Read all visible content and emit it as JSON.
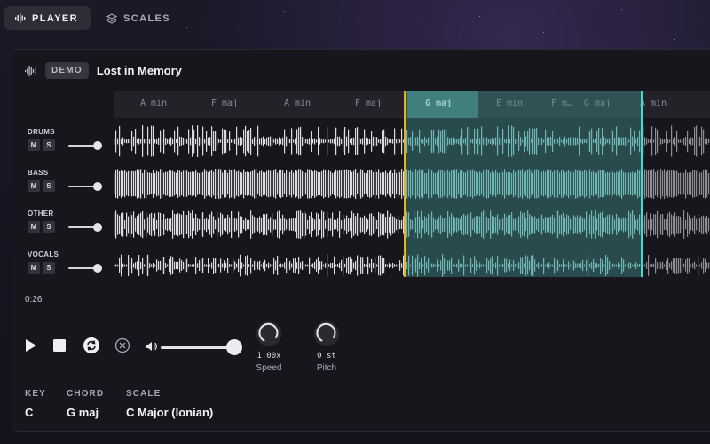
{
  "nav": {
    "tabs": [
      {
        "label": "PLAYER",
        "icon": "waveform-icon",
        "active": true
      },
      {
        "label": "SCALES",
        "icon": "layers-icon",
        "active": false
      }
    ]
  },
  "song": {
    "badge": "DEMO",
    "title": "Lost in Memory"
  },
  "chords": [
    {
      "label": "A min",
      "active": false
    },
    {
      "label": "F maj",
      "active": false
    },
    {
      "label": "A min",
      "active": false
    },
    {
      "label": "F maj",
      "active": false
    },
    {
      "label": "G maj",
      "active": true
    },
    {
      "label": "E min",
      "active": false
    },
    {
      "label": "F m…",
      "active": false
    },
    {
      "label": "G maj",
      "active": false
    },
    {
      "label": "A min",
      "active": false
    }
  ],
  "tracks": [
    {
      "name": "DRUMS",
      "mute": "M",
      "solo": "S"
    },
    {
      "name": "BASS",
      "mute": "M",
      "solo": "S"
    },
    {
      "name": "OTHER",
      "mute": "M",
      "solo": "S"
    },
    {
      "name": "VOCALS",
      "mute": "M",
      "solo": "S"
    }
  ],
  "playback": {
    "time": "0:26",
    "volume": 1.0
  },
  "controls": {
    "speed": {
      "value": "1.00x",
      "label": "Speed"
    },
    "pitch": {
      "value": "0 st",
      "label": "Pitch"
    }
  },
  "info": {
    "key": {
      "label": "KEY",
      "value": "C"
    },
    "chord": {
      "label": "CHORD",
      "value": "G maj"
    },
    "scale": {
      "label": "SCALE",
      "value": "C Major (Ionian)"
    }
  },
  "colors": {
    "accent": "#4ad8d0",
    "playhead": "#e6b422",
    "selection": "#46968f",
    "waveform": "#d9d9dd"
  }
}
